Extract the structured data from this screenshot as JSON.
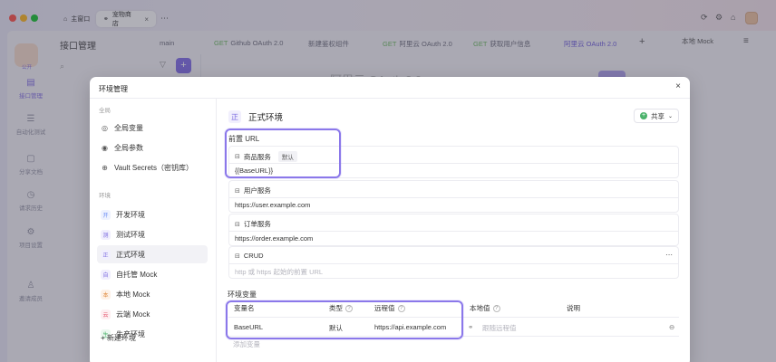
{
  "colors": {
    "accent": "#8b78ea",
    "red": "#ff5f57",
    "yellow": "#febc2e",
    "green": "#28c840"
  },
  "titlebar": {
    "tabs": [
      {
        "label": "主窗口",
        "icon": "home-icon"
      },
      {
        "label": "宠物商店",
        "icon": "link-icon"
      }
    ],
    "more": "⋯"
  },
  "rail": {
    "logo_text": "公开",
    "items": [
      {
        "label": "接口管理",
        "icon": "api-icon"
      },
      {
        "label": "自动化测试",
        "icon": "automation-icon"
      },
      {
        "label": "分享文档",
        "icon": "share-doc-icon"
      },
      {
        "label": "请求历史",
        "icon": "history-icon"
      },
      {
        "label": "项目设置",
        "icon": "settings-icon"
      },
      {
        "label": "邀请成员",
        "icon": "invite-icon"
      }
    ]
  },
  "background": {
    "title": "接口管理",
    "tabs": [
      {
        "method": "",
        "label": "main"
      },
      {
        "method": "GET",
        "label": "Github OAuth 2.0"
      },
      {
        "method": "",
        "label": "新建鉴权组件"
      },
      {
        "method": "GET",
        "label": "阿里云 OAuth 2.0"
      },
      {
        "method": "GET",
        "label": "获取用户信息"
      },
      {
        "method": "",
        "label": "阿里云 OAuth 2.0"
      }
    ],
    "env_select": "本地 Mock",
    "heading": "阿里云 OAuth 2.0"
  },
  "modal": {
    "title": "环境管理",
    "close": "×",
    "global_section": "全局",
    "global_items": [
      {
        "label": "全局变量",
        "icon": "globe-icon"
      },
      {
        "label": "全局参数",
        "icon": "param-icon"
      },
      {
        "label": "Vault Secrets（密钥库）",
        "icon": "vault-icon"
      }
    ],
    "env_section": "环境",
    "envs": [
      {
        "label": "开发环境",
        "badge": "开",
        "color": "#6d8ef5",
        "bg": "#eef2fe"
      },
      {
        "label": "测试环境",
        "badge": "测",
        "color": "#7b6ae0",
        "bg": "#f1effd"
      },
      {
        "label": "正式环境",
        "badge": "正",
        "color": "#7b6ae0",
        "bg": "#f1effd"
      },
      {
        "label": "自托管 Mock",
        "badge": "自",
        "color": "#7b6ae0",
        "bg": "#f1effd"
      },
      {
        "label": "本地 Mock",
        "badge": "本",
        "color": "#e08b3e",
        "bg": "#fdf1e7"
      },
      {
        "label": "云端 Mock",
        "badge": "云",
        "color": "#e55b72",
        "bg": "#fdeef1"
      },
      {
        "label": "生产环境",
        "badge": "生",
        "color": "#4bb36b",
        "bg": "#ebf7ef"
      }
    ],
    "new_env": "+ 新建环境",
    "current": {
      "badge": "正",
      "name": "正式环境",
      "share": "共享",
      "prefix_url_label": "前置 URL",
      "services": [
        {
          "name": "商品服务",
          "default_tag": "默认",
          "value": "{{BaseURL}}"
        },
        {
          "name": "用户服务",
          "value": "https://user.example.com"
        },
        {
          "name": "订单服务",
          "value": "https://order.example.com"
        },
        {
          "name": "CRUD",
          "placeholder": "http 或 https 起始的前置 URL",
          "more": "⋯"
        }
      ],
      "vars_label": "环境变量",
      "var_headers": [
        "变量名",
        "类型",
        "远程值",
        "本地值",
        "说明"
      ],
      "vars": [
        {
          "name": "BaseURL",
          "type": "默认",
          "remote": "https://api.example.com",
          "local_placeholder": "跟随远程值"
        }
      ],
      "add_var": "添加变量"
    }
  }
}
